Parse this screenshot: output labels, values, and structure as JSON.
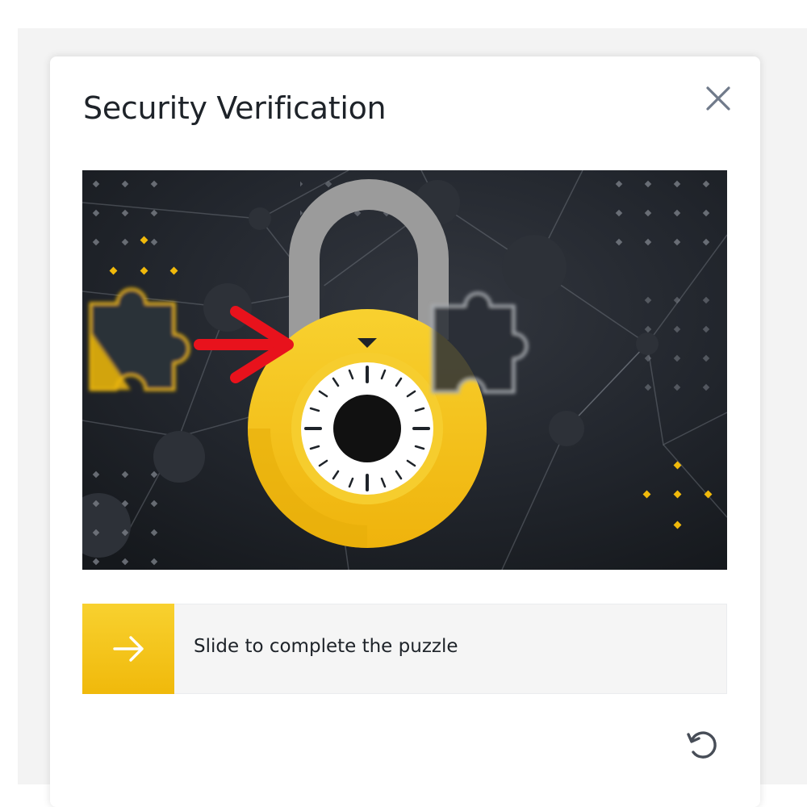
{
  "dialog": {
    "title": "Security Verification",
    "close_icon": "close-icon",
    "refresh_icon": "refresh-icon"
  },
  "puzzle": {
    "illustration": "padlock-with-puzzle-piece",
    "piece_icon": "puzzle-piece",
    "hint_arrow_icon": "red-arrow-right-icon",
    "colors": {
      "background": "#1c1f25",
      "accent": "#f0b90b",
      "hint_arrow": "#e8121c"
    }
  },
  "slider": {
    "label": "Slide to complete the puzzle",
    "handle_icon": "arrow-right-icon",
    "progress": 0,
    "colors": {
      "handle": "#f0b90b",
      "track": "#f5f5f5"
    }
  }
}
